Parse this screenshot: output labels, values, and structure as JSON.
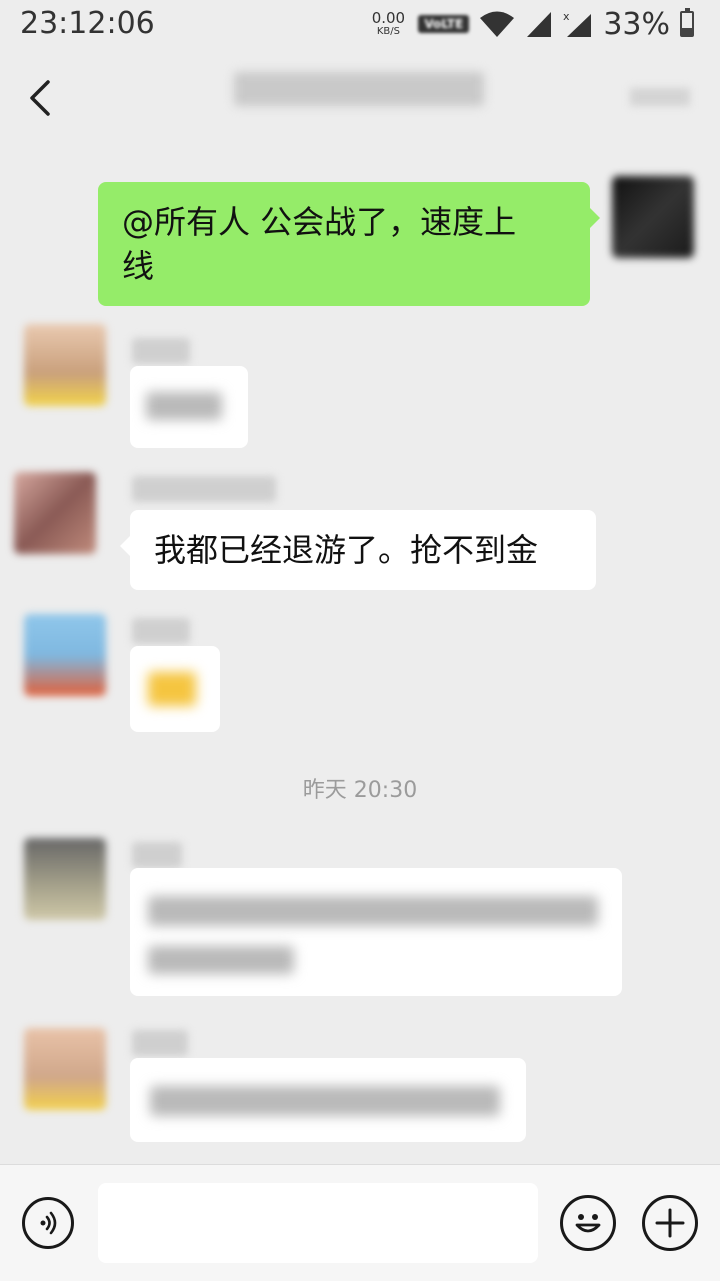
{
  "status_bar": {
    "time": "23:12:06",
    "net_speed_value": "0.00",
    "net_speed_unit": "KB/S",
    "volte_label": "VoLTE",
    "battery_percent": "33%"
  },
  "chat": {
    "messages": [
      {
        "sender": "self",
        "text_line1": "@所有人  公会战了，速度上",
        "text_line2": "线"
      },
      {
        "sender": "member",
        "text": ""
      },
      {
        "sender": "member",
        "text": "我都已经退游了。抢不到金"
      },
      {
        "sender": "member",
        "text": ""
      },
      {
        "sender": "member",
        "text": ""
      },
      {
        "sender": "member",
        "text": ""
      }
    ],
    "timestamp": "昨天 20:30"
  },
  "colors": {
    "background": "#ededed",
    "self_bubble": "#95ec69",
    "other_bubble": "#ffffff"
  },
  "icons": {
    "back": "chevron-left-icon",
    "voice": "voice-icon",
    "emoji": "emoji-icon",
    "plus": "plus-icon"
  }
}
